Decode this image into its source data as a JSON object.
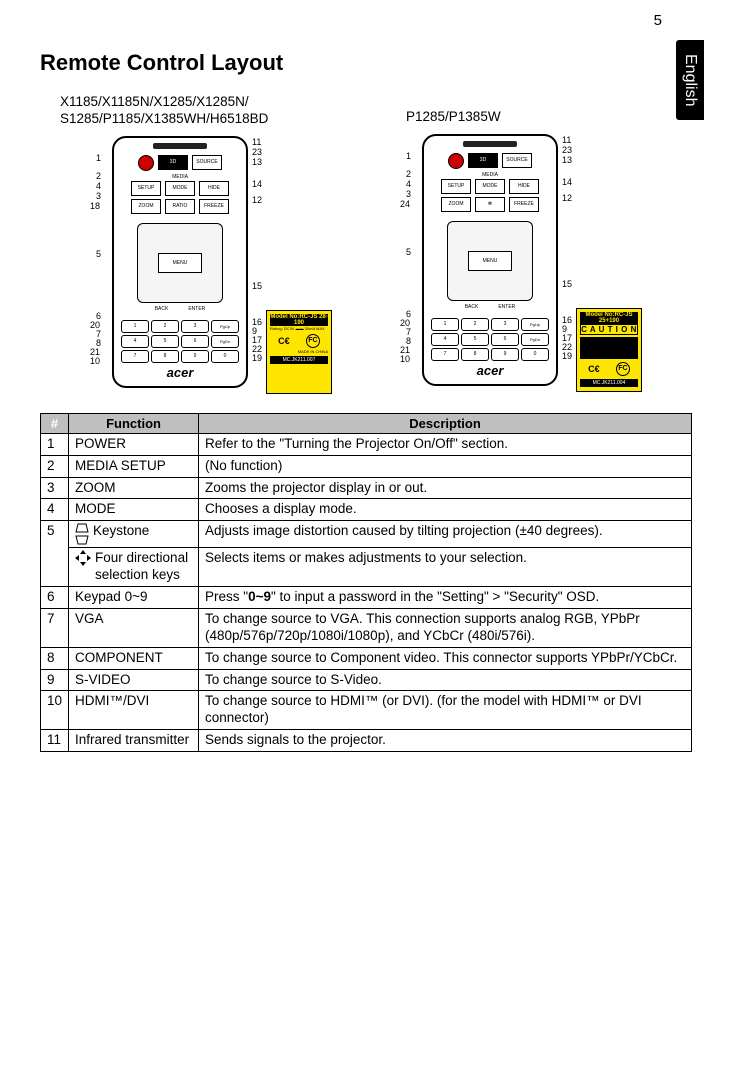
{
  "page_number": "5",
  "language_tab": "English",
  "title": "Remote Control Layout",
  "diagrams": [
    {
      "label_line1": "X1185/X1185N/X1285/X1285N/",
      "label_line2": "S1285/P1185/X1385WH/H6518BD",
      "sticker_model": "Model No:RC-JS 28-190",
      "sticker_footer": "MC.JK211.007",
      "brand": "acer",
      "left_callouts": [
        "1",
        "2",
        "4",
        "3",
        "18",
        "5",
        "6",
        "20",
        "7",
        "8",
        "21",
        "10"
      ],
      "right_callouts": [
        "11",
        "23",
        "13",
        "14",
        "12",
        "15",
        "16",
        "9",
        "17",
        "22",
        "19"
      ]
    },
    {
      "label_line1": "P1285/P1385W",
      "label_line2": "",
      "sticker_model": "Model No:RC-JS 25+190",
      "sticker_caution": "C A U T I O N",
      "sticker_footer": "MC.JK211.004",
      "brand": "acer",
      "left_callouts": [
        "1",
        "2",
        "4",
        "3",
        "24",
        "5",
        "6",
        "20",
        "7",
        "8",
        "21",
        "10"
      ],
      "right_callouts": [
        "11",
        "23",
        "13",
        "14",
        "12",
        "15",
        "16",
        "9",
        "17",
        "22",
        "19"
      ]
    }
  ],
  "table": {
    "headers": {
      "num": "#",
      "fn": "Function",
      "desc": "Description"
    },
    "rows": [
      {
        "num": "1",
        "fn": "POWER",
        "desc": "Refer to the \"Turning the Projector On/Off\" section."
      },
      {
        "num": "2",
        "fn": "MEDIA SETUP",
        "desc": "(No function)"
      },
      {
        "num": "3",
        "fn": "ZOOM",
        "desc": "Zooms the projector display in or out."
      },
      {
        "num": "4",
        "fn": "MODE",
        "desc": "Chooses a display mode."
      },
      {
        "num": "5",
        "fn_icon": "keystone",
        "fn": "Keystone",
        "desc": "Adjusts image distortion caused by tilting projection (±40 degrees)."
      },
      {
        "num": "",
        "fn_icon": "fourdir",
        "fn": "Four directional selection keys",
        "desc": "Selects items or makes adjustments to your selection."
      },
      {
        "num": "6",
        "fn": "Keypad 0~9",
        "desc_pre": "Press \"",
        "desc_bold": "0~9",
        "desc_post": "\" to input a password in the \"Setting\" > \"Security\" OSD."
      },
      {
        "num": "7",
        "fn": "VGA",
        "desc": "To change source to VGA. This connection supports analog RGB, YPbPr (480p/576p/720p/1080i/1080p), and YCbCr (480i/576i)."
      },
      {
        "num": "8",
        "fn": "COMPONENT",
        "desc": "To change source to Component video. This connector supports YPbPr/YCbCr."
      },
      {
        "num": "9",
        "fn": "S-VIDEO",
        "desc": "To change source to S-Video."
      },
      {
        "num": "10",
        "fn": "HDMI™/DVI",
        "desc": "To change source to HDMI™ (or DVI). (for the model with HDMI™ or DVI connector)"
      },
      {
        "num": "11",
        "fn": "Infrared transmitter",
        "desc": "Sends signals to the projector."
      }
    ]
  }
}
